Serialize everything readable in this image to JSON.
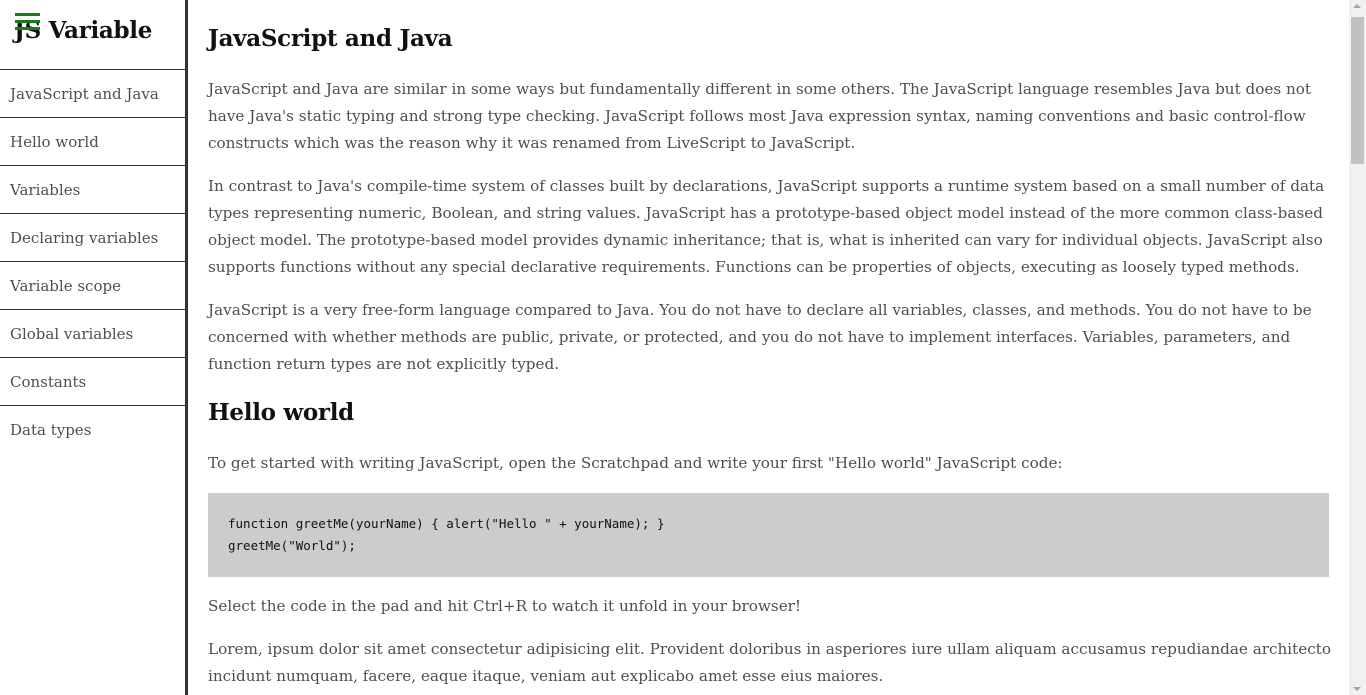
{
  "sidebar": {
    "title": "JS Variable",
    "menu_icon": "hamburger-menu-icon",
    "accent_color": "#1a7a1a",
    "items": [
      {
        "label": "JavaScript and Java"
      },
      {
        "label": "Hello world"
      },
      {
        "label": "Variables"
      },
      {
        "label": "Declaring variables"
      },
      {
        "label": "Variable scope"
      },
      {
        "label": "Global variables"
      },
      {
        "label": "Constants"
      },
      {
        "label": "Data types"
      }
    ]
  },
  "main": {
    "sections": [
      {
        "heading": "JavaScript and Java",
        "paragraphs": [
          "JavaScript and Java are similar in some ways but fundamentally different in some others. The JavaScript language resembles Java but does not have Java's static typing and strong type checking. JavaScript follows most Java expression syntax, naming conventions and basic control-flow constructs which was the reason why it was renamed from LiveScript to JavaScript.",
          "In contrast to Java's compile-time system of classes built by declarations, JavaScript supports a runtime system based on a small number of data types representing numeric, Boolean, and string values. JavaScript has a prototype-based object model instead of the more common class-based object model. The prototype-based model provides dynamic inheritance; that is, what is inherited can vary for individual objects. JavaScript also supports functions without any special declarative requirements. Functions can be properties of objects, executing as loosely typed methods.",
          "JavaScript is a very free-form language compared to Java. You do not have to declare all variables, classes, and methods. You do not have to be concerned with whether methods are public, private, or protected, and you do not have to implement interfaces. Variables, parameters, and function return types are not explicitly typed."
        ]
      },
      {
        "heading": "Hello world",
        "intro": "To get started with writing JavaScript, open the Scratchpad and write your first \"Hello world\" JavaScript code:",
        "code": [
          "function greetMe(yourName) { alert(\"Hello \" + yourName); }",
          "greetMe(\"World\");"
        ],
        "paragraphs": [
          "Select the code in the pad and hit Ctrl+R to watch it unfold in your browser!",
          "Lorem, ipsum dolor sit amet consectetur adipisicing elit. Provident doloribus in asperiores iure ullam aliquam accusamus repudiandae architecto incidunt numquam, facere, eaque itaque, veniam aut explicabo amet esse eius maiores."
        ]
      }
    ]
  },
  "colors": {
    "text": "#4d4e53",
    "heading": "#111111",
    "code_background": "#cccccc",
    "border": "#333333"
  }
}
